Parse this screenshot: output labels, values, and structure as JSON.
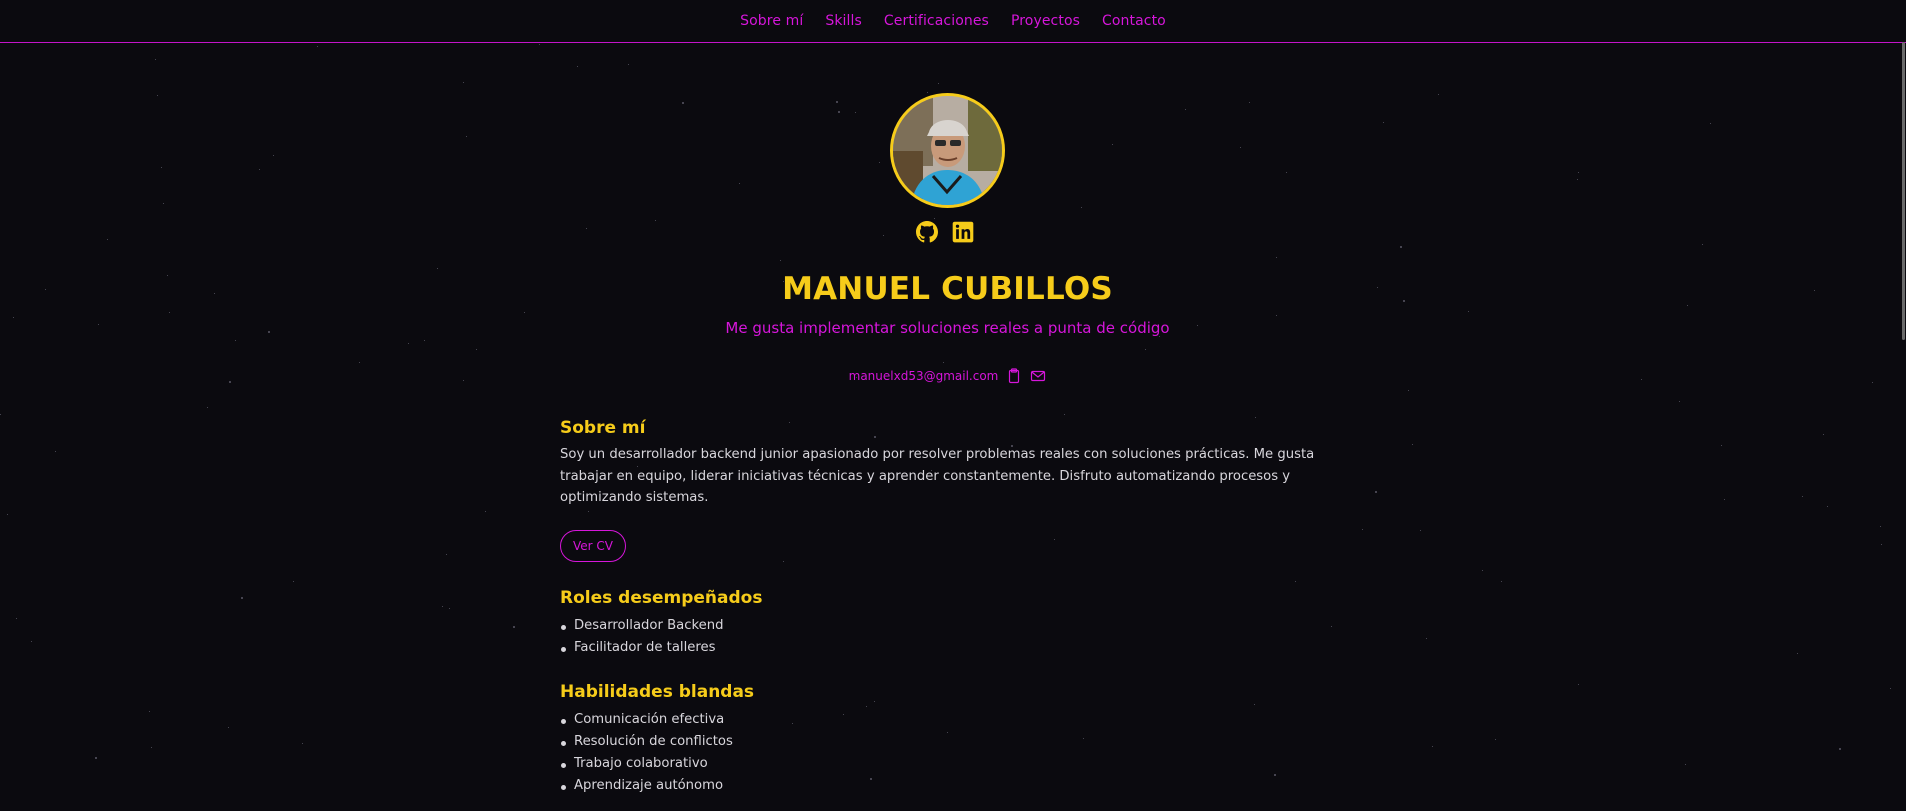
{
  "nav": {
    "items": [
      "Sobre mí",
      "Skills",
      "Certificaciones",
      "Proyectos",
      "Contacto"
    ]
  },
  "profile": {
    "name": "MANUEL CUBILLOS",
    "tagline": "Me gusta implementar soluciones reales a punta de código",
    "email": "manuelxd53@gmail.com",
    "socials": [
      "github-icon",
      "linkedin-icon"
    ]
  },
  "about": {
    "title": "Sobre mí",
    "text": "Soy un desarrollador backend junior apasionado por resolver problemas reales con soluciones prácticas. Me gusta trabajar en equipo, liderar iniciativas técnicas y aprender constantemente. Disfruto automatizando procesos y optimizando sistemas.",
    "cv_button": "Ver CV"
  },
  "roles": {
    "title": "Roles desempeñados",
    "items": [
      "Desarrollador Backend",
      "Facilitador de talleres"
    ]
  },
  "soft_skills": {
    "title": "Habilidades blandas",
    "items": [
      "Comunicación efectiva",
      "Resolución de conflictos",
      "Trabajo colaborativo",
      "Aprendizaje autónomo"
    ]
  },
  "colors": {
    "background": "#0b0a0f",
    "accent_magenta": "#d616da",
    "accent_yellow": "#f6cc1a",
    "text": "#d8d6dc"
  }
}
